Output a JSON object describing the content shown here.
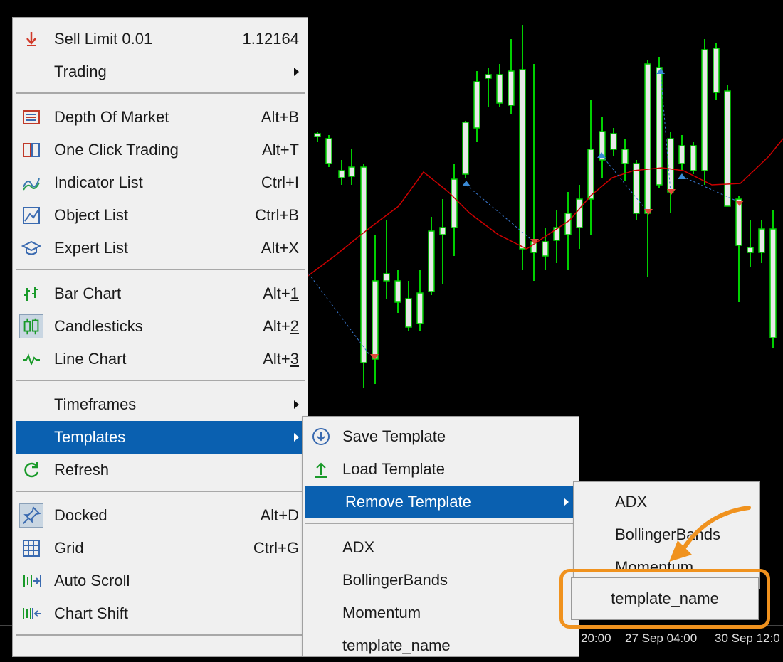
{
  "context_menu": {
    "items": [
      {
        "label": "Sell Limit 0.01",
        "shortcut": "1.12164",
        "icon": "sell-limit-icon"
      },
      {
        "label": "Trading",
        "submenu": true
      },
      {
        "label": "Depth Of Market",
        "shortcut": "Alt+B",
        "icon": "depth-of-market-icon"
      },
      {
        "label": "One Click Trading",
        "shortcut": "Alt+T",
        "icon": "one-click-trading-icon"
      },
      {
        "label": "Indicator List",
        "shortcut": "Ctrl+I",
        "icon": "indicator-list-icon"
      },
      {
        "label": "Object List",
        "shortcut": "Ctrl+B",
        "icon": "object-list-icon"
      },
      {
        "label": "Expert List",
        "shortcut": "Alt+X",
        "icon": "expert-list-icon"
      },
      {
        "label": "Bar Chart",
        "shortcut": "Alt+1",
        "icon": "bar-chart-icon"
      },
      {
        "label": "Candlesticks",
        "shortcut": "Alt+2",
        "icon": "candlesticks-icon"
      },
      {
        "label": "Line Chart",
        "shortcut": "Alt+3",
        "icon": "line-chart-icon"
      },
      {
        "label": "Timeframes",
        "submenu": true
      },
      {
        "label": "Templates",
        "submenu": true
      },
      {
        "label": "Refresh",
        "icon": "refresh-icon"
      },
      {
        "label": "Docked",
        "shortcut": "Alt+D",
        "icon": "pin-icon"
      },
      {
        "label": "Grid",
        "shortcut": "Ctrl+G",
        "icon": "grid-icon"
      },
      {
        "label": "Auto Scroll",
        "icon": "auto-scroll-icon"
      },
      {
        "label": "Chart Shift",
        "icon": "chart-shift-icon"
      }
    ]
  },
  "templates_menu": {
    "items": [
      {
        "label": "Save Template",
        "icon": "save-template-icon"
      },
      {
        "label": "Load Template",
        "icon": "load-template-icon"
      },
      {
        "label": "Remove Template",
        "submenu": true
      },
      {
        "label": "ADX"
      },
      {
        "label": "BollingerBands"
      },
      {
        "label": "Momentum"
      },
      {
        "label": "template_name"
      }
    ]
  },
  "remove_template_menu": {
    "items": [
      {
        "label": "ADX"
      },
      {
        "label": "BollingerBands"
      },
      {
        "label": "Momentum"
      }
    ],
    "highlighted": "template_name"
  },
  "time_axis": [
    "20:00",
    "27 Sep 04:00",
    "30 Sep 12:0"
  ],
  "colors": {
    "accent": "#0a60b0",
    "highlight": "#f0921e",
    "bull": "#00e000",
    "line": "#cc0000"
  }
}
